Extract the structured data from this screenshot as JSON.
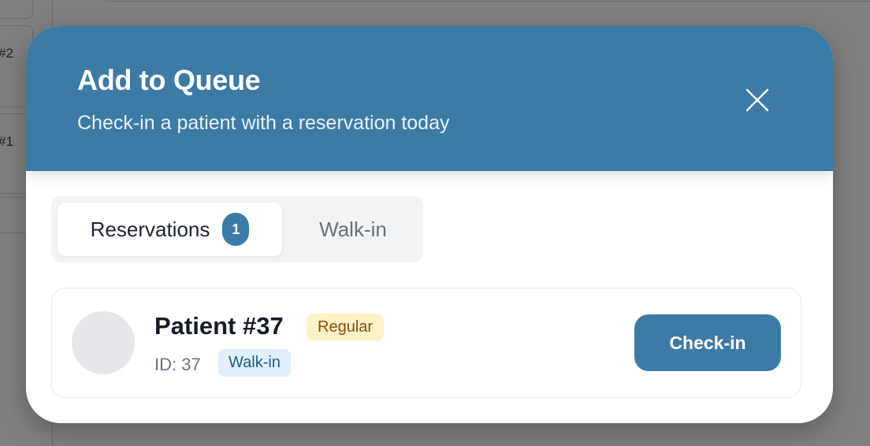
{
  "background": {
    "queue_labels": [
      "#2",
      "#1"
    ]
  },
  "modal": {
    "title": "Add to Queue",
    "subtitle": "Check-in a patient with a reservation today",
    "close_icon": "close-icon"
  },
  "tabs": [
    {
      "label": "Reservations",
      "count": "1",
      "active": true
    },
    {
      "label": "Walk-in",
      "active": false
    }
  ],
  "reservations": [
    {
      "name": "Patient #37",
      "type_badge": "Regular",
      "id_label": "ID: 37",
      "source_badge": "Walk-in",
      "action_label": "Check-in"
    }
  ],
  "colors": {
    "primary": "#3c7ba6",
    "regular_badge_bg": "#fdf3c7",
    "walkin_badge_bg": "#e1effc"
  }
}
